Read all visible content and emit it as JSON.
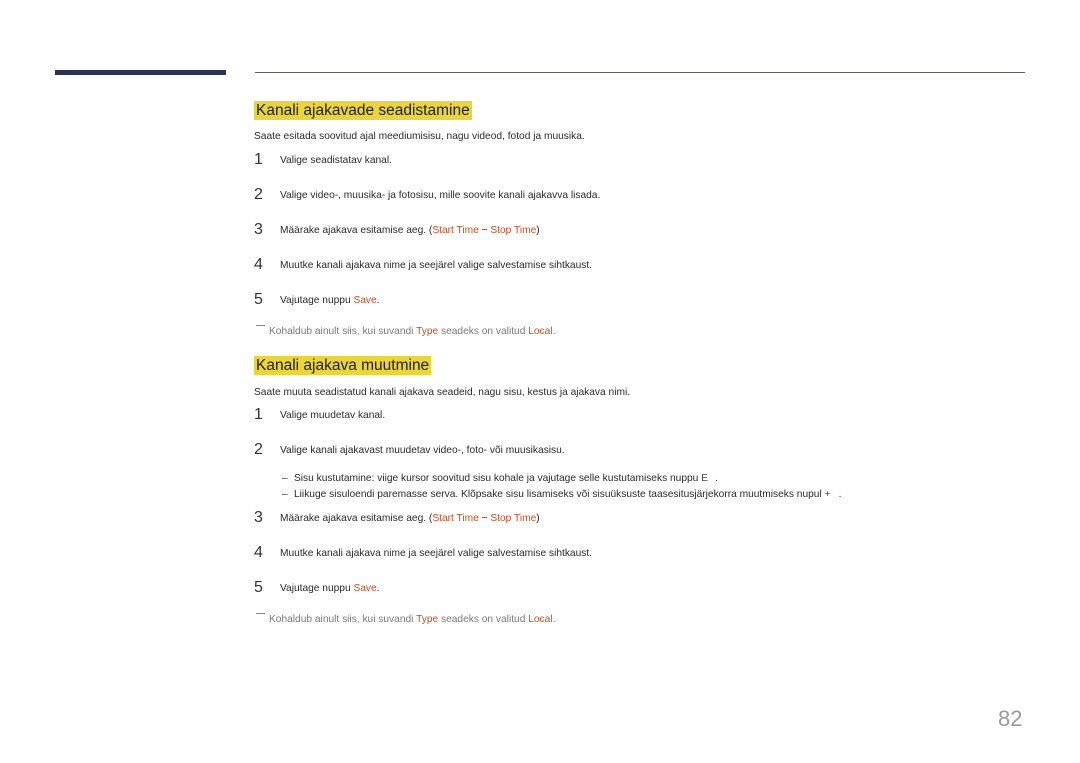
{
  "page_number": "82",
  "colors": {
    "accent": "#d24a1e",
    "highlight": "#e9d53b",
    "top_bar": "#2c3350"
  },
  "section1": {
    "title": "Kanali ajakavade seadistamine",
    "intro": "Saate esitada soovitud ajal meediumisisu, nagu videod, fotod ja muusika.",
    "steps": [
      {
        "num": "1",
        "text": "Valige seadistatav kanal."
      },
      {
        "num": "2",
        "text": "Valige video-, muusika- ja fotosisu, mille soovite kanali ajakavva lisada."
      },
      {
        "num": "3",
        "pre": "Määrake ajakava esitamise aeg. (",
        "a1": "Start Time",
        "mid": " ~ ",
        "a2": "Stop Time",
        "post": ")"
      },
      {
        "num": "4",
        "text": "Muutke kanali ajakava nime ja seejärel valige salvestamise sihtkaust."
      },
      {
        "num": "5",
        "pre": "Vajutage nuppu ",
        "a1": "Save",
        "post": "."
      }
    ],
    "note": {
      "pre": "Kohaldub ainult siis, kui suvandi ",
      "a1": "Type",
      "mid": " seadeks on valitud ",
      "a2": "Local",
      "post": "."
    }
  },
  "section2": {
    "title": "Kanali ajakava muutmine",
    "intro": "Saate muuta seadistatud kanali ajakava seadeid, nagu sisu, kestus ja ajakava nimi.",
    "steps": [
      {
        "num": "1",
        "text": "Valige muudetav kanal."
      },
      {
        "num": "2",
        "text": "Valige kanali ajakavast muudetav video-, foto- või muusikasisu."
      },
      {
        "num": "3",
        "pre": "Määrake ajakava esitamise aeg. (",
        "a1": "Start Time",
        "mid": " ~ ",
        "a2": "Stop Time",
        "post": ")"
      },
      {
        "num": "4",
        "text": "Muutke kanali ajakava nime ja seejärel valige salvestamise sihtkaust."
      },
      {
        "num": "5",
        "pre": "Vajutage nuppu ",
        "a1": "Save",
        "post": "."
      }
    ],
    "subitems": [
      {
        "dash": "–",
        "text": "Sisu kustutamine: viige kursor soovitud sisu kohale ja vajutage selle kustutamiseks nuppu ",
        "icon": "E",
        "post": "."
      },
      {
        "dash": "–",
        "text": "Liikuge sisuloendi paremasse serva. Klõpsake sisu lisamiseks või sisuüksuste taasesitusjärjekorra muutmiseks nupul ",
        "icon": "+",
        "post": "."
      }
    ],
    "note": {
      "pre": "Kohaldub ainult siis, kui suvandi ",
      "a1": "Type",
      "mid": " seadeks on valitud ",
      "a2": "Local",
      "post": "."
    }
  }
}
